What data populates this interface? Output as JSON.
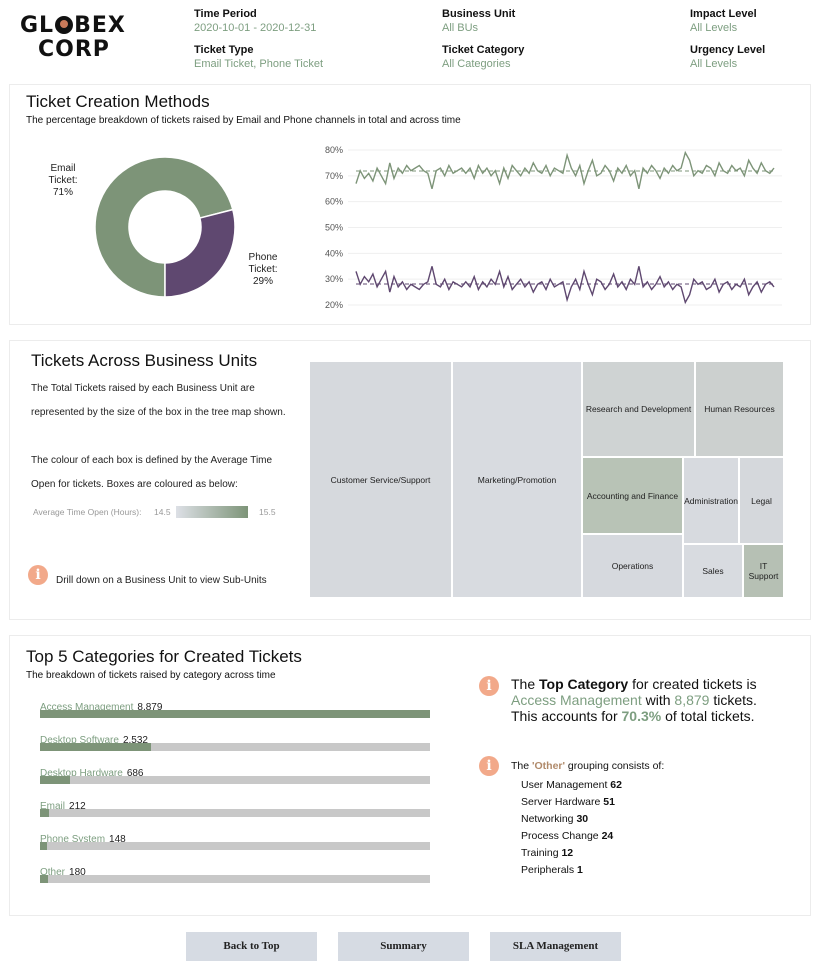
{
  "header": {
    "logo_line1_a": "GL",
    "logo_line1_b": "BEX",
    "logo_line2": "CORP",
    "filters": [
      {
        "label": "Time Period",
        "value": "2020-10-01 - 2020-12-31"
      },
      {
        "label": "Business Unit",
        "value": "All BUs"
      },
      {
        "label": "Impact Level",
        "value": "All Levels"
      },
      {
        "label": "Ticket Type",
        "value": "Email Ticket, Phone Ticket"
      },
      {
        "label": "Ticket Category",
        "value": "All Categories"
      },
      {
        "label": "Urgency Level",
        "value": "All Levels"
      }
    ]
  },
  "methods": {
    "title": "Ticket Creation Methods",
    "subtitle": "The percentage breakdown of tickets raised by Email and Phone channels in total and across time",
    "email_label": [
      "Email",
      "Ticket:",
      "71%"
    ],
    "phone_label": [
      "Phone",
      "Ticket:",
      "29%"
    ]
  },
  "units": {
    "title": "Tickets Across Business Units",
    "desc1": "The Total Tickets raised by each Business Unit are",
    "desc2": "represented by the size of the box in the tree map shown.",
    "desc3": "The colour of each box is defined by the Average Time",
    "desc4": "Open for tickets. Boxes are coloured as below:",
    "legend_label": "Average Time Open (Hours):",
    "legend_min": "14.5",
    "legend_max": "15.5",
    "drill_note": "Drill down on a Business Unit to view  Sub-Units",
    "treemap": [
      {
        "name": "Customer Service/Support",
        "color": "#d6d9dd"
      },
      {
        "name": "Marketing/Promotion",
        "color": "#d8dbe0"
      },
      {
        "name": "Research and Development",
        "color": "#cfd3d3"
      },
      {
        "name": "Human Resources",
        "color": "#ccd0cf"
      },
      {
        "name": "Accounting and Finance",
        "color": "#b8c3b6"
      },
      {
        "name": "Administration",
        "color": "#d7dadf"
      },
      {
        "name": "Legal",
        "color": "#d5d8dc"
      },
      {
        "name": "Operations",
        "color": "#d6d9de"
      },
      {
        "name": "Sales",
        "color": "#d8dbe0"
      },
      {
        "name": "IT Support",
        "color": "#b6c0b4"
      }
    ]
  },
  "categories": {
    "title": "Top 5 Categories for Created Tickets",
    "subtitle": "The breakdown of tickets raised by category across time",
    "items": [
      {
        "name": "Access Management",
        "value": "8,879",
        "share": 1.0
      },
      {
        "name": "Desktop Software",
        "value": "2,532",
        "share": 0.285
      },
      {
        "name": "Desktop Hardware",
        "value": "686",
        "share": 0.077
      },
      {
        "name": "Email",
        "value": "212",
        "share": 0.024
      },
      {
        "name": "Phone System",
        "value": "148",
        "share": 0.017
      },
      {
        "name": "Other",
        "value": "180",
        "share": 0.02
      }
    ],
    "top_text": {
      "p1": "The ",
      "p2": "Top Category",
      "p3": " for created tickets is",
      "p4": "Access Management",
      "p5": " with ",
      "p6": "8,879",
      "p7": " tickets.",
      "p8": "This accounts for ",
      "p9": "70.3%",
      "p10": " of total tickets."
    },
    "other_intro_a": "The ",
    "other_intro_b": "'Other'",
    "other_intro_c": " grouping consists of:",
    "other_items": [
      {
        "name": "User Management",
        "value": "62"
      },
      {
        "name": "Server Hardware",
        "value": "51"
      },
      {
        "name": "Networking",
        "value": "30"
      },
      {
        "name": "Process Change",
        "value": "24"
      },
      {
        "name": "Training",
        "value": "12"
      },
      {
        "name": "Peripherals",
        "value": "1"
      }
    ]
  },
  "buttons": {
    "back": "Back to Top",
    "summary": "Summary",
    "sla": "SLA Management"
  },
  "colors": {
    "email": "#7d9478",
    "phone": "#5f4870",
    "accent_green": "#7d9e80",
    "info_orange": "#f2a98a"
  },
  "chart_data": [
    {
      "type": "pie",
      "title": "",
      "categories": [
        "Email Ticket",
        "Phone Ticket"
      ],
      "values": [
        71,
        29
      ]
    },
    {
      "type": "line",
      "title": "",
      "ylim": [
        20,
        80
      ],
      "yticks": [
        "80%",
        "70%",
        "60%",
        "50%",
        "40%",
        "30%",
        "20%"
      ],
      "series": [
        {
          "values": [
            67,
            72,
            69,
            71,
            68,
            73,
            70,
            67,
            75,
            69,
            73,
            71,
            74,
            72,
            73,
            74,
            72,
            71,
            65,
            72,
            73,
            70,
            74,
            71,
            72,
            73,
            71,
            73,
            69,
            74,
            71,
            73,
            70,
            72,
            67,
            73,
            69,
            74,
            72,
            70,
            73,
            71,
            75,
            72,
            71,
            74,
            70,
            73,
            72,
            71,
            78,
            73,
            70,
            74,
            67,
            72,
            76,
            70,
            71,
            74,
            72,
            68,
            73,
            71,
            74,
            70,
            72,
            65,
            73,
            71,
            74,
            72,
            69,
            73,
            71,
            74,
            72,
            73,
            79,
            76,
            70,
            72,
            71,
            74,
            73,
            70,
            75,
            72,
            71,
            74,
            72,
            73,
            70,
            76,
            73,
            71,
            75,
            72,
            71,
            73
          ]
        },
        {
          "values": [
            33,
            28,
            31,
            29,
            32,
            27,
            30,
            33,
            25,
            31,
            27,
            29,
            26,
            28,
            27,
            26,
            28,
            29,
            35,
            28,
            27,
            30,
            26,
            29,
            28,
            27,
            29,
            27,
            31,
            26,
            29,
            27,
            30,
            28,
            33,
            27,
            31,
            26,
            28,
            30,
            27,
            29,
            25,
            28,
            29,
            26,
            30,
            27,
            28,
            29,
            22,
            27,
            30,
            26,
            33,
            28,
            24,
            30,
            29,
            26,
            28,
            32,
            27,
            29,
            26,
            30,
            28,
            35,
            27,
            29,
            26,
            28,
            31,
            27,
            29,
            26,
            28,
            27,
            21,
            24,
            30,
            28,
            29,
            26,
            27,
            30,
            25,
            28,
            29,
            26,
            28,
            27,
            30,
            24,
            27,
            29,
            25,
            28,
            29,
            27
          ]
        }
      ]
    },
    {
      "type": "bar",
      "title": "",
      "categories": [
        "Access Management",
        "Desktop Software",
        "Desktop Hardware",
        "Email",
        "Phone System",
        "Other"
      ],
      "values": [
        8879,
        2532,
        686,
        212,
        148,
        180
      ]
    }
  ]
}
